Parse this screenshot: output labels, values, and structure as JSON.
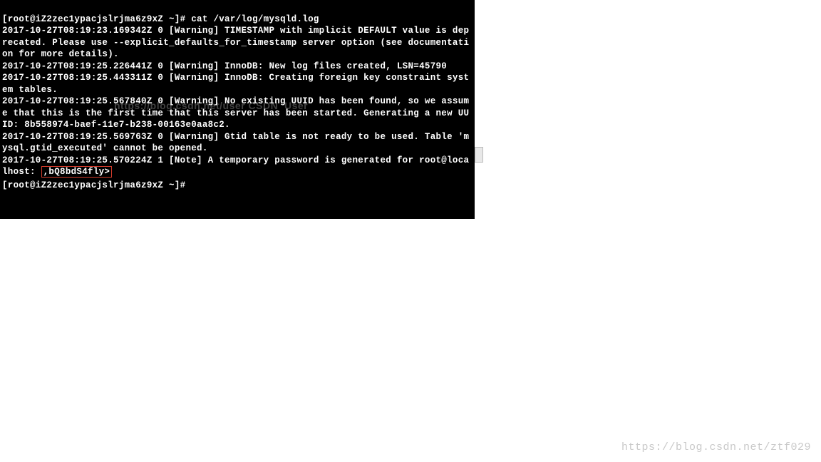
{
  "terminal": {
    "prompt1_user": "[root@iZ2zec1ypacjslrjma6z9xZ ~]# ",
    "command": "cat /var/log/mysqld.log",
    "line_warn1": "2017-10-27T08:19:23.169342Z 0 [Warning] TIMESTAMP with implicit DEFAULT value is deprecated. Please use --explicit_defaults_for_timestamp server option (see documentation for more details).",
    "line_warn2": "2017-10-27T08:19:25.226441Z 0 [Warning] InnoDB: New log files created, LSN=45790",
    "line_warn3": "2017-10-27T08:19:25.443311Z 0 [Warning] InnoDB: Creating foreign key constraint system tables.",
    "line_warn4": "2017-10-27T08:19:25.567840Z 0 [Warning] No existing UUID has been found, so we assume that this is the first time that this server has been started. Generating a new UUID: 8b558974-baef-11e7-b238-00163e0aa8c2.",
    "line_warn5": "2017-10-27T08:19:25.569763Z 0 [Warning] Gtid table is not ready to be used. Table 'mysql.gtid_executed' cannot be opened.",
    "line_note_part1": "2017-10-27T08:19:25.570224Z 1 [Note] A temporary password is generated for root@localhost: ",
    "password_highlight": ",bQ8bdS4fly>",
    "prompt2": "[root@iZ2zec1ypacjslrjma6z9xZ ~]# "
  },
  "watermark_overlay": "https://blog.csdn.net/user CSDN  User",
  "watermark_bottom": "https://blog.csdn.net/ztf029"
}
